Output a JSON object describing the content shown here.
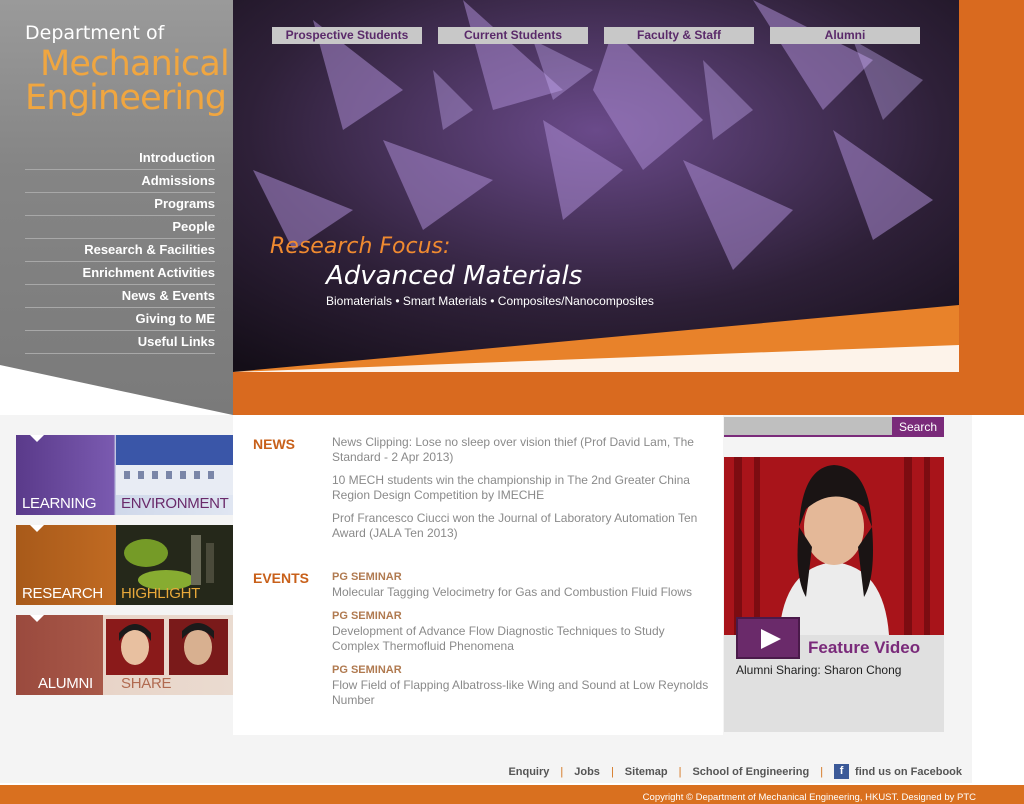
{
  "colors": {
    "accent_orange": "#d96a1f",
    "brand_purple": "#7a2a7a",
    "panel_gray": "#888888"
  },
  "logo": {
    "line1": "Department of",
    "line2": "Mechanical",
    "line3": "Engineering"
  },
  "main_nav": [
    "Introduction",
    "Admissions",
    "Programs",
    "People",
    "Research & Facilities",
    "Enrichment Activities",
    "News & Events",
    "Giving to ME",
    "Useful Links"
  ],
  "top_tabs": [
    "Prospective Students",
    "Current Students",
    "Faculty & Staff",
    "Alumni"
  ],
  "hero": {
    "label": "Research Focus:",
    "title": "Advanced Materials",
    "subtitle": "Biomaterials • Smart Materials • Composites/Nanocomposites"
  },
  "tiles": [
    {
      "label_a": "LEARNING",
      "label_b": "ENVIRONMENT"
    },
    {
      "label_a": "RESEARCH",
      "label_b": "HIGHLIGHT"
    },
    {
      "label_a": "ALUMNI",
      "label_b": "SHARE"
    }
  ],
  "news": {
    "heading": "NEWS",
    "items": [
      "News Clipping: Lose no sleep over vision thief (Prof David Lam, The Standard - 2 Apr 2013)",
      "10 MECH students win the championship in The 2nd Greater China Region Design Competition by IMECHE",
      "Prof Francesco Ciucci won the Journal of Laboratory Automation Ten Award (JALA Ten 2013)"
    ]
  },
  "events": {
    "heading": "EVENTS",
    "items": [
      {
        "tag": "PG SEMINAR",
        "text": "Molecular Tagging Velocimetry for Gas and Combustion Fluid Flows"
      },
      {
        "tag": "PG SEMINAR",
        "text": "Development of Advance Flow Diagnostic Techniques to Study Complex Thermofluid Phenomena"
      },
      {
        "tag": "PG SEMINAR",
        "text": "Flow Field of Flapping Albatross-like Wing and Sound at Low Reynolds Number"
      }
    ]
  },
  "search": {
    "button_label": "Search",
    "value": ""
  },
  "feature_video": {
    "title": "Feature Video",
    "caption": "Alumni Sharing: Sharon Chong",
    "icon": "play-icon"
  },
  "footer": {
    "links": [
      "Enquiry",
      "Jobs",
      "Sitemap",
      "School of Engineering"
    ],
    "facebook": "find us on Facebook",
    "copyright": "Copyright © Department of Mechanical Engineering, HKUST.  Designed by PTC"
  }
}
